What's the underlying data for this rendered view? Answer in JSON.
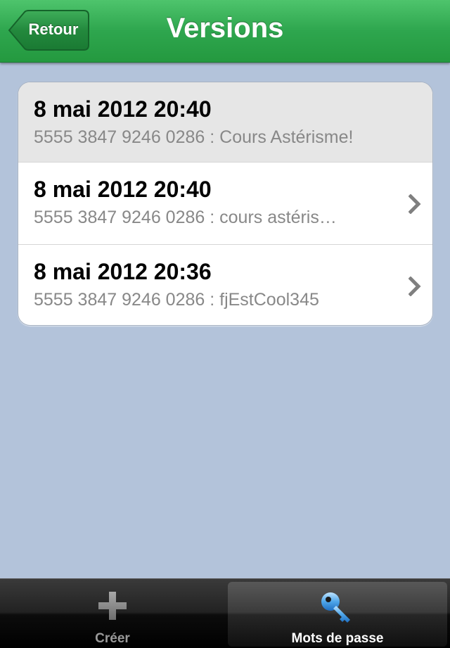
{
  "navbar": {
    "title": "Versions",
    "back_label": "Retour"
  },
  "versions": [
    {
      "date": "8 mai 2012 20:40",
      "detail": "5555 3847 9246 0286 : Cours Astérisme!",
      "selected": true,
      "disclosure": false
    },
    {
      "date": "8 mai 2012 20:40",
      "detail": "5555 3847 9246 0286 : cours astéris…",
      "selected": false,
      "disclosure": true
    },
    {
      "date": "8 mai 2012 20:36",
      "detail": "5555 3847 9246 0286 : fjEstCool345",
      "selected": false,
      "disclosure": true
    }
  ],
  "tabbar": {
    "create": {
      "label": "Créer",
      "icon": "plus-icon"
    },
    "passwords": {
      "label": "Mots de passe",
      "icon": "key-icon",
      "active": true
    }
  },
  "colors": {
    "navbar": "#2ea64e",
    "background": "#b3c3da",
    "selected_row": "#e6e6e6"
  }
}
